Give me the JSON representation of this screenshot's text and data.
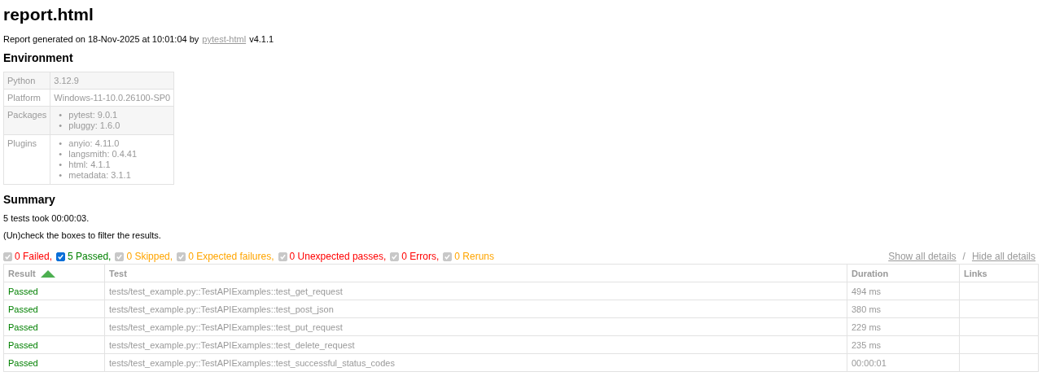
{
  "title": "report.html",
  "generated": {
    "prefix": "Report generated on 18-Nov-2025 at 10:01:04 by",
    "link": "pytest-html",
    "suffix": "v4.1.1"
  },
  "environment": {
    "heading": "Environment",
    "rows": [
      {
        "key": "Python",
        "values": [
          "3.12.9"
        ],
        "kind": "text"
      },
      {
        "key": "Platform",
        "values": [
          "Windows-11-10.0.26100-SP0"
        ],
        "kind": "text"
      },
      {
        "key": "Packages",
        "bullet": "•",
        "values": [
          "pytest: 9.0.1",
          "pluggy: 1.6.0"
        ],
        "kind": "list"
      },
      {
        "key": "Plugins",
        "bullet": "•",
        "values": [
          "anyio: 4.11.0",
          "langsmith: 0.4.41",
          "html: 4.1.1",
          "metadata: 3.1.1"
        ],
        "kind": "list"
      }
    ]
  },
  "summary": {
    "heading": "Summary",
    "duration": "5 tests took 00:00:03.",
    "hint": "(Un)check the boxes to filter the results."
  },
  "filters": [
    {
      "label": "0 Failed,",
      "checked": true,
      "disabled": true,
      "color": "#ff0000"
    },
    {
      "label": "5 Passed,",
      "checked": true,
      "disabled": false,
      "color": "#008000"
    },
    {
      "label": "0 Skipped,",
      "checked": true,
      "disabled": true,
      "color": "#ffa500"
    },
    {
      "label": "0 Expected failures,",
      "checked": true,
      "disabled": true,
      "color": "#ffa500"
    },
    {
      "label": "0 Unexpected passes,",
      "checked": true,
      "disabled": true,
      "color": "#ff0000"
    },
    {
      "label": "0 Errors,",
      "checked": true,
      "disabled": true,
      "color": "#ff0000"
    },
    {
      "label": "0 Reruns",
      "checked": true,
      "disabled": true,
      "color": "#ffa500"
    }
  ],
  "details_links": {
    "show": "Show all details",
    "separator": "/",
    "hide": "Hide all details"
  },
  "table": {
    "columns": [
      "Result",
      "Test",
      "Duration",
      "Links"
    ],
    "rows": [
      {
        "result": "Passed",
        "test": "tests/test_example.py::TestAPIExamples::test_get_request",
        "duration": "494 ms"
      },
      {
        "result": "Passed",
        "test": "tests/test_example.py::TestAPIExamples::test_post_json",
        "duration": "380 ms"
      },
      {
        "result": "Passed",
        "test": "tests/test_example.py::TestAPIExamples::test_put_request",
        "duration": "229 ms"
      },
      {
        "result": "Passed",
        "test": "tests/test_example.py::TestAPIExamples::test_delete_request",
        "duration": "235 ms"
      },
      {
        "result": "Passed",
        "test": "tests/test_example.py::TestAPIExamples::test_successful_status_codes",
        "duration": "00:00:01"
      }
    ]
  }
}
